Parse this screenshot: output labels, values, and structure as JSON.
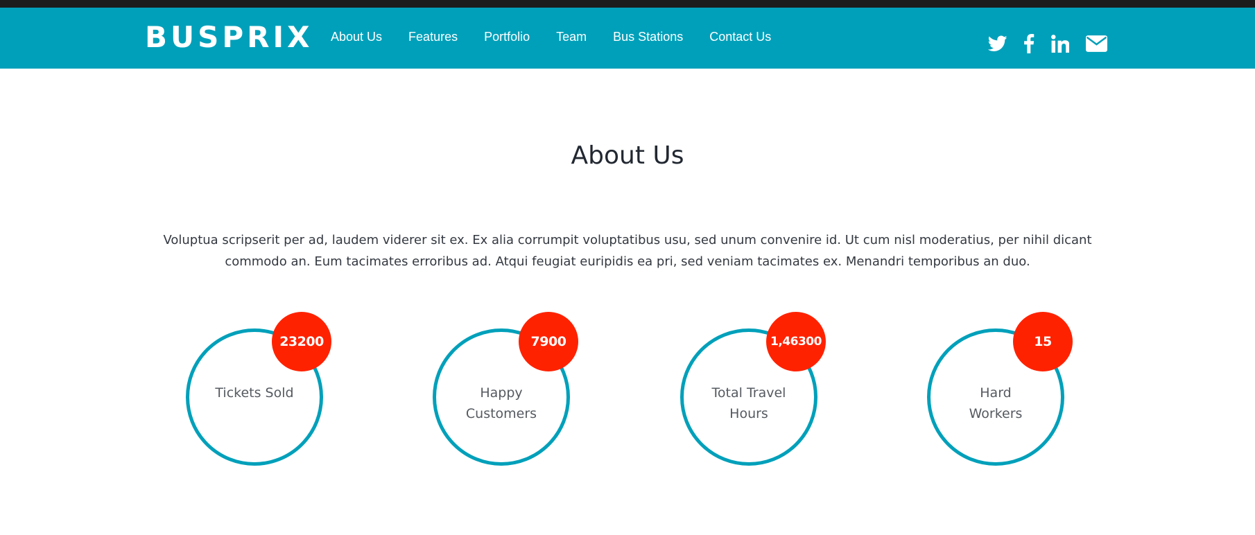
{
  "brand": {
    "name": "BUSPRIX"
  },
  "nav": {
    "links": [
      "About Us",
      "Features",
      "Portfolio",
      "Team",
      "Bus Stations",
      "Contact Us"
    ]
  },
  "social": [
    "twitter-icon",
    "facebook-icon",
    "linkedin-icon",
    "envelope-icon"
  ],
  "about": {
    "title": "About Us",
    "intro_line1": "Voluptua scripserit per ad, laudem viderer sit ex. Ex alia corrumpit voluptatibus usu, sed unum convenire id. Ut cum nisl moderatius, per nihil dicant",
    "intro_line2": "commodo an. Eum tacimates erroribus ad. Atqui feugiat euripidis ea pri, sed veniam tacimates ex. Menandri temporibus an duo."
  },
  "stats": [
    {
      "value": "23200",
      "label_line1": "Tickets Sold",
      "label_line2": ""
    },
    {
      "value": "7900",
      "label_line1": "Happy",
      "label_line2": "Customers"
    },
    {
      "value": "1,46300",
      "label_line1": "Total Travel",
      "label_line2": "Hours"
    },
    {
      "value": "15",
      "label_line1": "Hard",
      "label_line2": "Workers"
    }
  ],
  "colors": {
    "accent": "#00a0ba",
    "badge": "#ff2200",
    "heading": "#222831",
    "text": "#333840"
  }
}
